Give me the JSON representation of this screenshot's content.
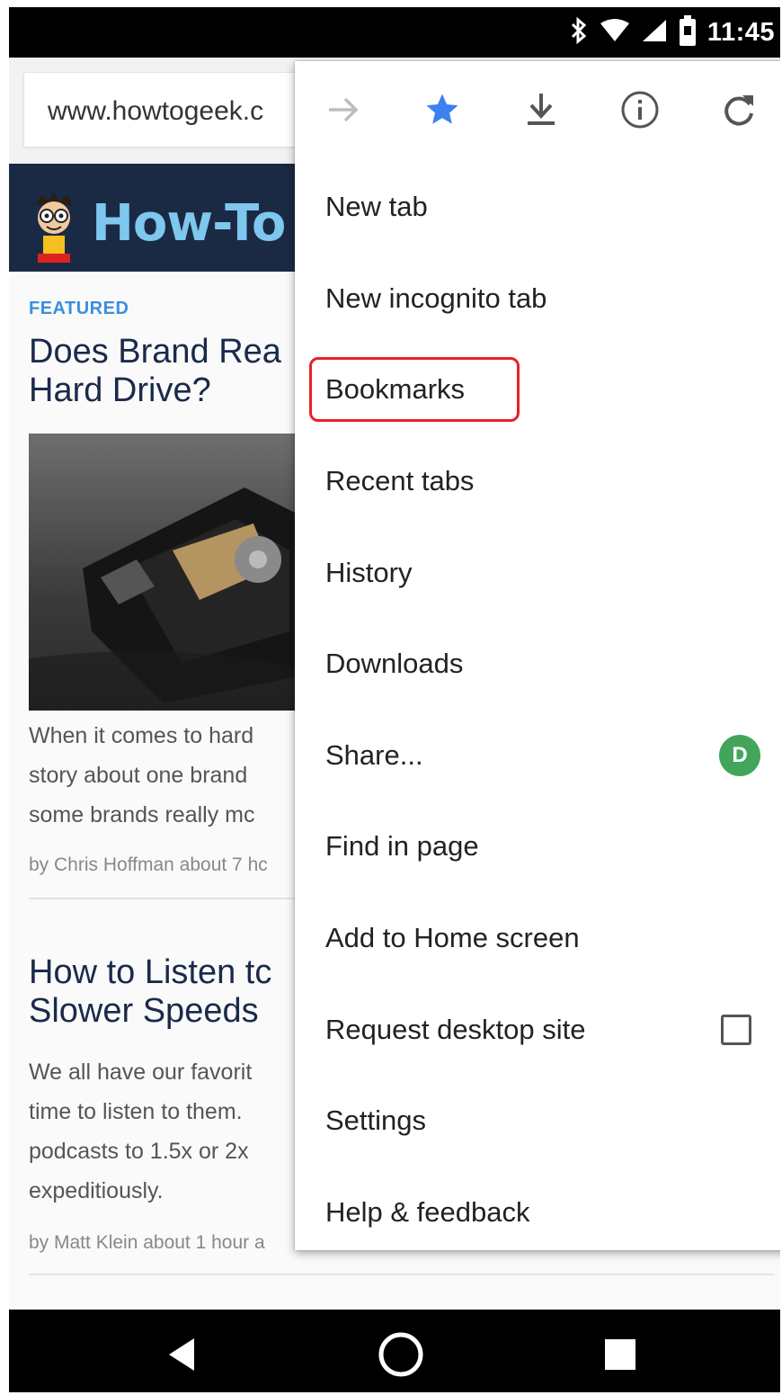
{
  "status_bar": {
    "time": "11:45"
  },
  "browser": {
    "url": "www.howtogeek.c"
  },
  "site": {
    "logo_text": "How-To Ge",
    "featured_label": "FEATURED",
    "article1": {
      "title_line1": "Does Brand Rea",
      "title_line2": "Hard Drive?",
      "excerpt_lines": [
        "When it comes to hard",
        "story about one brand",
        "some brands really mc"
      ],
      "byline": "by Chris Hoffman about 7 hc"
    },
    "article2": {
      "title_line1": "How to Listen tc",
      "title_line2": "Slower Speeds",
      "excerpt_lines": [
        "We all have our favorit",
        "time to listen to them.",
        "podcasts to 1.5x or 2x",
        "expeditiously."
      ],
      "byline": "by Matt Klein about 1 hour a"
    }
  },
  "menu": {
    "toolbar_icons": [
      "forward-icon",
      "star-icon",
      "download-icon",
      "info-icon",
      "reload-icon"
    ],
    "items": [
      {
        "label": "New tab"
      },
      {
        "label": "New incognito tab"
      },
      {
        "label": "Bookmarks",
        "highlighted": true
      },
      {
        "label": "Recent tabs"
      },
      {
        "label": "History"
      },
      {
        "label": "Downloads"
      },
      {
        "label": "Share..."
      },
      {
        "label": "Find in page"
      },
      {
        "label": "Add to Home screen"
      },
      {
        "label": "Request desktop site",
        "checkbox": false
      },
      {
        "label": "Settings"
      },
      {
        "label": "Help & feedback"
      }
    ],
    "share_badge_text": "D",
    "accent_color": "#3b82f0",
    "highlight_color": "#e8202a"
  },
  "nav_bar": {
    "icons": [
      "back-icon",
      "home-icon",
      "recents-icon"
    ]
  }
}
